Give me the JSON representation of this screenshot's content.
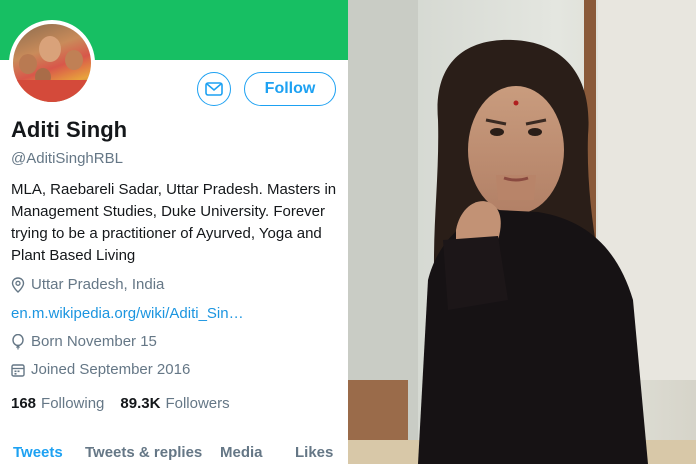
{
  "colors": {
    "accent": "#1da1f2",
    "banner": "#17bf63",
    "text": "#14171a",
    "muted": "#657786",
    "link": "#1b95e0"
  },
  "profile": {
    "name": "Aditi Singh",
    "handle": "@AditiSinghRBL",
    "bio": "MLA, Raebareli Sadar, Uttar Pradesh. Masters in Management Studies, Duke University. Forever trying to be a practitioner of Ayurved, Yoga and Plant Based Living",
    "location": "Uttar Pradesh, India",
    "website": "en.m.wikipedia.org/wiki/Aditi_Sin…",
    "birthday": "Born November 15",
    "joined": "Joined September 2016",
    "following_count": "168",
    "following_label": "Following",
    "followers_count": "89.3K",
    "followers_label": "Followers"
  },
  "actions": {
    "follow_label": "Follow",
    "message_icon": "envelope-icon"
  },
  "tabs": [
    {
      "label": "Tweets",
      "active": true
    },
    {
      "label": "Tweets & replies",
      "active": false
    },
    {
      "label": "Media",
      "active": false
    },
    {
      "label": "Likes",
      "active": false
    }
  ],
  "icons": {
    "location": "location-pin-icon",
    "website": "link-icon",
    "birthday": "balloon-icon",
    "joined": "calendar-icon"
  }
}
